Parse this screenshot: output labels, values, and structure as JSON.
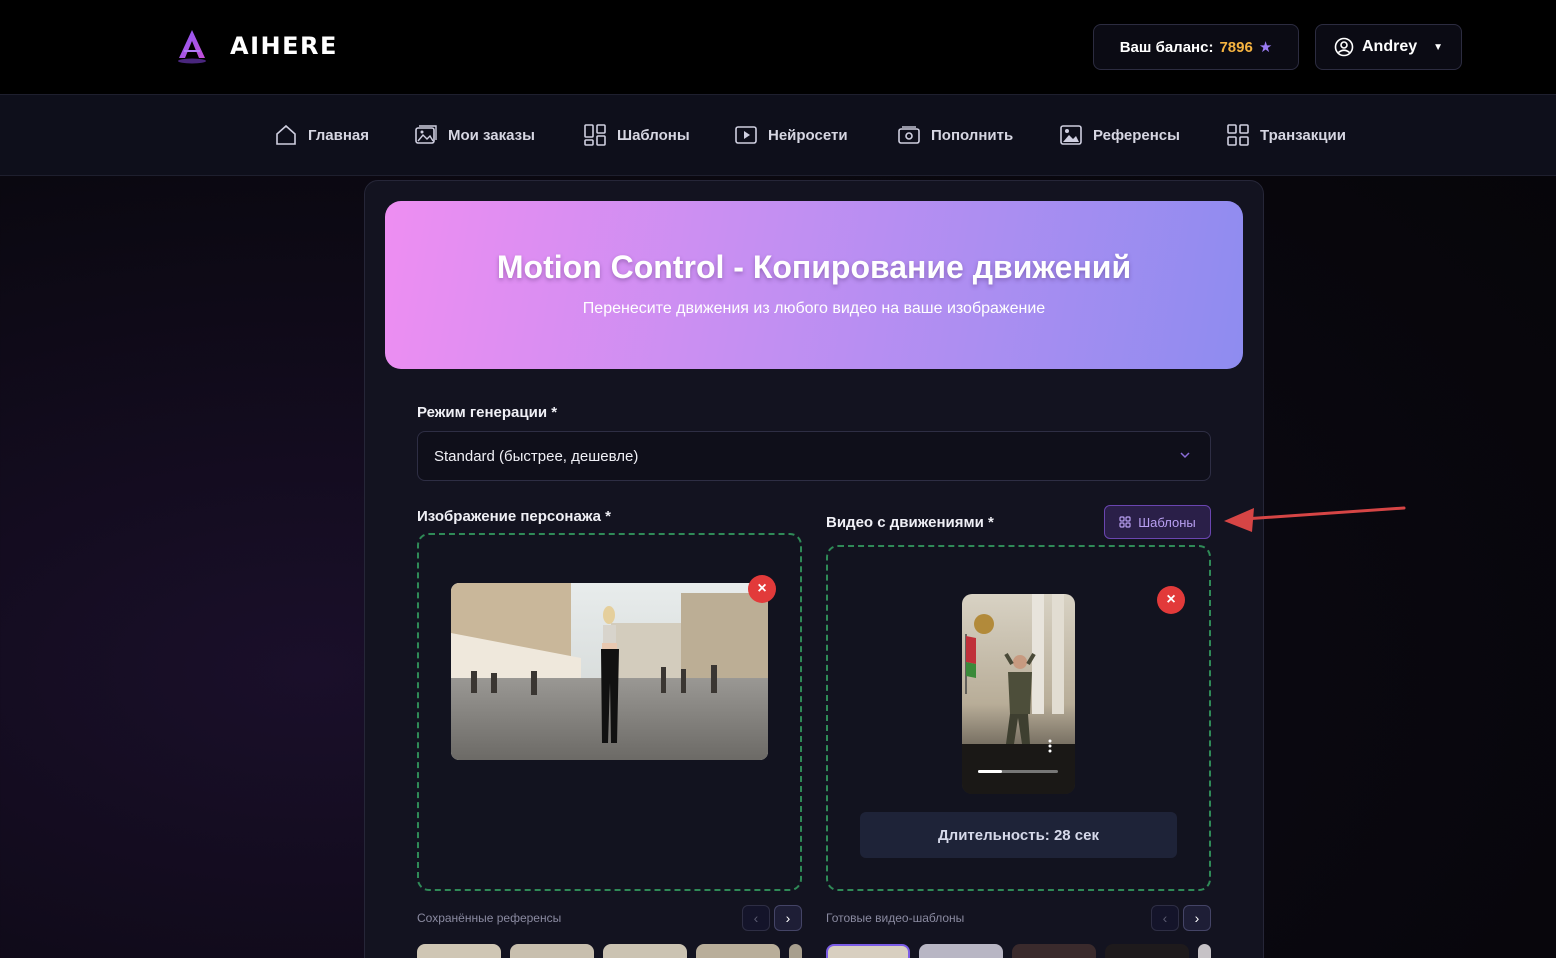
{
  "header": {
    "brand": "AIHERE",
    "balance_label": "Ваш баланс:",
    "balance_value": "7896",
    "user_name": "Andrey"
  },
  "nav": {
    "items": [
      {
        "label": "Главная",
        "icon": "home-icon"
      },
      {
        "label": "Мои заказы",
        "icon": "image-gallery-icon"
      },
      {
        "label": "Шаблоны",
        "icon": "grid-icon"
      },
      {
        "label": "Нейросети",
        "icon": "play-icon"
      },
      {
        "label": "Пополнить",
        "icon": "wallet-icon"
      },
      {
        "label": "Референсы",
        "icon": "picture-icon"
      },
      {
        "label": "Транзакции",
        "icon": "grid-icon"
      }
    ]
  },
  "hero": {
    "title": "Motion Control - Копирование движений",
    "subtitle": "Перенесите движения из любого видео на ваше изображение"
  },
  "form": {
    "mode_label": "Режим генерации *",
    "mode_value": "Standard (быстрее, дешевле)",
    "image_label": "Изображение персонажа *",
    "video_label": "Видео с движениями *",
    "templates_button": "Шаблоны",
    "duration": "Длительность: 28 сек",
    "saved_refs_label": "Сохранённые референсы",
    "video_templates_label": "Готовые видео-шаблоны"
  },
  "colors": {
    "accent": "#9b7cf5",
    "balance_value": "#f5b340",
    "dropzone_border": "#2f8a57",
    "close": "#e23a3a",
    "annotation_arrow": "#d64545"
  }
}
